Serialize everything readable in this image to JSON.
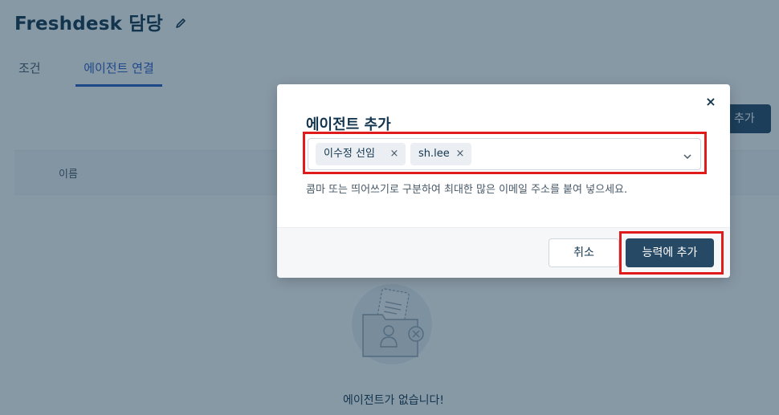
{
  "page": {
    "title": "Freshdesk 담당",
    "tabs": [
      {
        "label": "조건"
      },
      {
        "label": "에이전트 연결"
      }
    ],
    "add_button": "추가",
    "table": {
      "col_name": "이름"
    },
    "empty_text": "에이전트가 없습니다!"
  },
  "modal": {
    "title": "에이전트 추가",
    "selected_agents": [
      {
        "label": "이수정 선임"
      },
      {
        "label": "sh.lee"
      }
    ],
    "chip_remove_glyph": "×",
    "help_text": "콤마 또는 띄어쓰기로 구분하여 최대한 많은 이메일 주소를 붙여 넣으세요.",
    "cancel_label": "취소",
    "submit_label": "능력에 추가",
    "close_glyph": "×"
  },
  "colors": {
    "primary": "#264966",
    "tab_active": "#2c5cc5",
    "highlight": "#e01b1b",
    "text": "#12344d"
  },
  "icons": {
    "edit": "pencil-icon",
    "close": "close-icon",
    "dropdown": "chevron-down-icon",
    "empty": "empty-agents-illustration"
  }
}
